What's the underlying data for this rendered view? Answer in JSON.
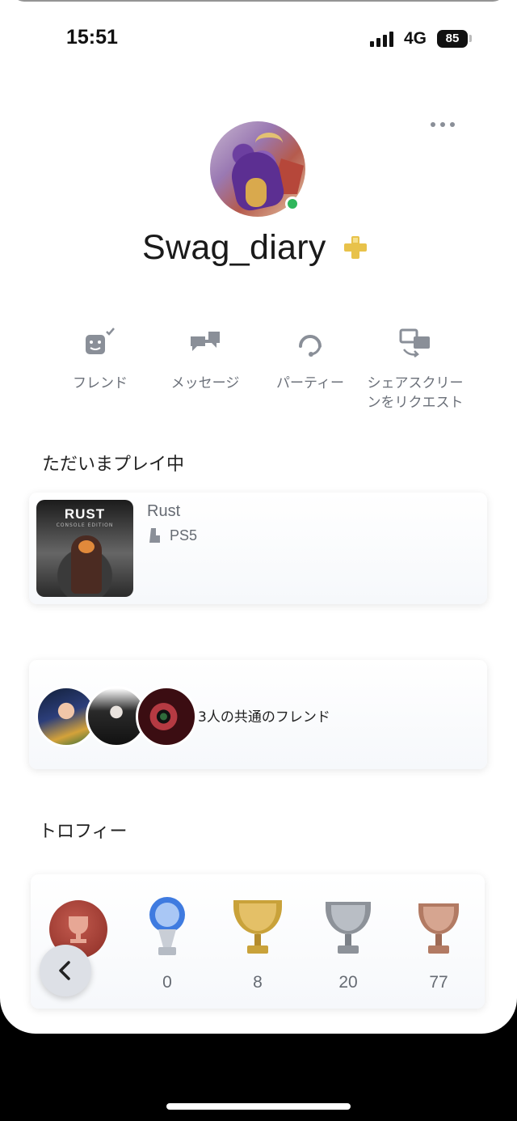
{
  "status_bar": {
    "time": "15:51",
    "network": "4G",
    "battery": "85"
  },
  "profile": {
    "username": "Swag_diary",
    "online": true,
    "plus_member": true
  },
  "actions": [
    {
      "label": "フレンド",
      "icon": "friend-request-icon"
    },
    {
      "label": "メッセージ",
      "icon": "message-icon"
    },
    {
      "label": "パーティー",
      "icon": "headset-icon"
    },
    {
      "label": "シェアスクリー\nンをリクエスト",
      "icon": "share-screen-icon"
    }
  ],
  "now_playing": {
    "section_title": "ただいまプレイ中",
    "game_name": "Rust",
    "platform": "PS5",
    "thumb_title": "RUST",
    "thumb_subtitle": "CONSOLE EDITION"
  },
  "mutual_friends": {
    "text": "3人の共通のフレンド",
    "count": 3
  },
  "trophies": {
    "section_title": "トロフィー",
    "items": [
      {
        "type": "platinum",
        "count": "0"
      },
      {
        "type": "gold",
        "count": "8"
      },
      {
        "type": "silver",
        "count": "20"
      },
      {
        "type": "bronze",
        "count": "77"
      }
    ]
  },
  "colors": {
    "online": "#2fb65b",
    "plus": "#e8c24a",
    "secondary_text": "#6b7079"
  }
}
